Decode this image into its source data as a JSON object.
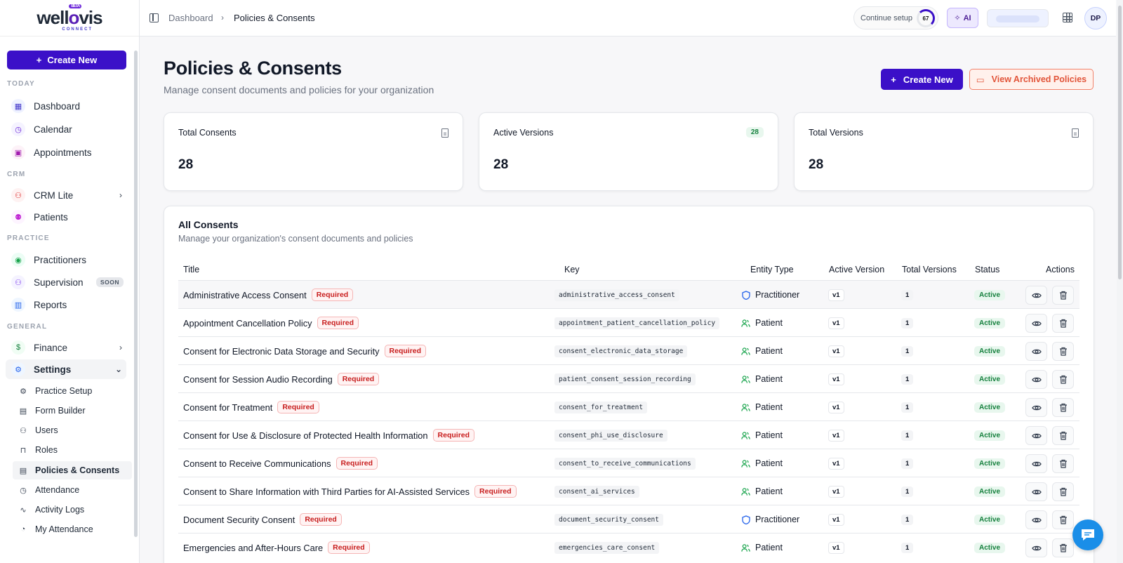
{
  "brand": {
    "name_part1": "well",
    "name_o": "o",
    "name_part2": "vis",
    "sub": "CONNECT",
    "badge": "BETA"
  },
  "sidebar": {
    "create_label": "Create New",
    "sections": {
      "today": "TODAY",
      "crm": "CRM",
      "practice": "PRACTICE",
      "general": "GENERAL"
    },
    "items": {
      "dashboard": "Dashboard",
      "calendar": "Calendar",
      "appointments": "Appointments",
      "crm_lite": "CRM Lite",
      "patients": "Patients",
      "practitioners": "Practitioners",
      "supervision": "Supervision",
      "supervision_badge": "SOON",
      "reports": "Reports",
      "finance": "Finance",
      "settings": "Settings"
    },
    "settings_sub": {
      "practice_setup": "Practice Setup",
      "form_builder": "Form Builder",
      "users": "Users",
      "roles": "Roles",
      "policies": "Policies & Consents",
      "attendance": "Attendance",
      "activity_logs": "Activity Logs",
      "my_attendance": "My Attendance"
    }
  },
  "topbar": {
    "breadcrumb": [
      "Dashboard",
      "Policies & Consents"
    ],
    "continue_label": "Continue setup",
    "progress": "67",
    "ai_label": "AI",
    "avatar_initials": "DP"
  },
  "page": {
    "title": "Policies & Consents",
    "subtitle": "Manage consent documents and policies for your organization",
    "create_label": "Create New",
    "archived_label": "View Archived Policies"
  },
  "stats": {
    "total_consents": {
      "label": "Total Consents",
      "value": "28"
    },
    "active_versions": {
      "label": "Active Versions",
      "value": "28",
      "badge": "28"
    },
    "total_versions": {
      "label": "Total Versions",
      "value": "28"
    }
  },
  "table": {
    "title": "All Consents",
    "subtitle": "Manage your organization's consent documents and policies",
    "columns": {
      "title": "Title",
      "key": "Key",
      "entity": "Entity Type",
      "active_version": "Active Version",
      "total_versions": "Total Versions",
      "status": "Status",
      "actions": "Actions"
    },
    "rows": [
      {
        "title": "Administrative Access Consent",
        "tag": "Required",
        "key": "administrative_access_consent",
        "entity": "Practitioner",
        "version": "v1",
        "total": "1",
        "status": "Active"
      },
      {
        "title": "Appointment Cancellation Policy",
        "tag": "Required",
        "key": "appointment_patient_cancellation_policy",
        "entity": "Patient",
        "version": "v1",
        "total": "1",
        "status": "Active"
      },
      {
        "title": "Consent for Electronic Data Storage and Security",
        "tag": "Required",
        "key": "consent_electronic_data_storage",
        "entity": "Patient",
        "version": "v1",
        "total": "1",
        "status": "Active"
      },
      {
        "title": "Consent for Session Audio Recording",
        "tag": "Required",
        "key": "patient_consent_session_recording",
        "entity": "Patient",
        "version": "v1",
        "total": "1",
        "status": "Active"
      },
      {
        "title": "Consent for Treatment",
        "tag": "Required",
        "key": "consent_for_treatment",
        "entity": "Patient",
        "version": "v1",
        "total": "1",
        "status": "Active"
      },
      {
        "title": "Consent for Use & Disclosure of Protected Health Information",
        "tag": "Required",
        "key": "consent_phi_use_disclosure",
        "entity": "Patient",
        "version": "v1",
        "total": "1",
        "status": "Active"
      },
      {
        "title": "Consent to Receive Communications",
        "tag": "Required",
        "key": "consent_to_receive_communications",
        "entity": "Patient",
        "version": "v1",
        "total": "1",
        "status": "Active"
      },
      {
        "title": "Consent to Share Information with Third Parties for AI-Assisted Services",
        "tag": "Required",
        "key": "consent_ai_services",
        "entity": "Patient",
        "version": "v1",
        "total": "1",
        "status": "Active"
      },
      {
        "title": "Document Security Consent",
        "tag": "Required",
        "key": "document_security_consent",
        "entity": "Practitioner",
        "version": "v1",
        "total": "1",
        "status": "Active"
      },
      {
        "title": "Emergencies and After-Hours Care",
        "tag": "Required",
        "key": "emergencies_care_consent",
        "entity": "Patient",
        "version": "v1",
        "total": "1",
        "status": "Active"
      }
    ]
  },
  "colors": {
    "primary": "#3b10c8",
    "danger": "#e2553a",
    "success": "#15803d",
    "chat": "#1a8ee8"
  }
}
